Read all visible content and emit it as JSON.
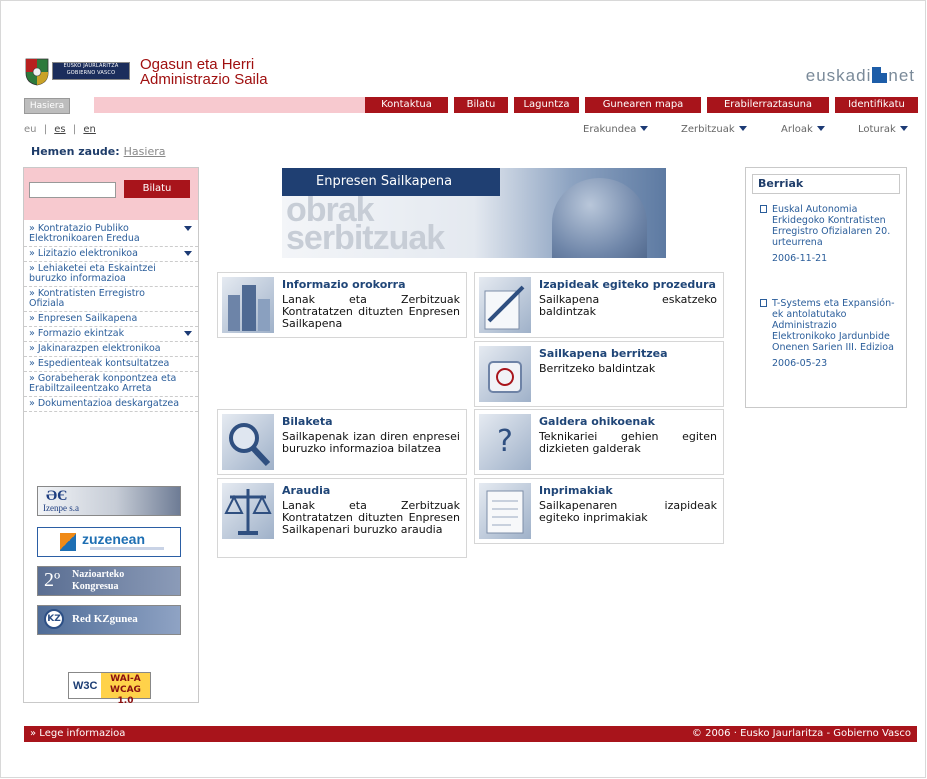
{
  "header": {
    "logo_line1": "EUSKO JAURLARITZA",
    "logo_line2": "GOBIERNO VASCO",
    "dept_line1": "Ogasun eta Herri",
    "dept_line2": "Administrazio Saila",
    "brand_left": "euskadi",
    "brand_right": "net"
  },
  "navbar": {
    "home": "Hasiera",
    "buttons": [
      "Kontaktua",
      "Bilatu",
      "Laguntza",
      "Gunearen mapa",
      "Erabilerraztasuna",
      "Identifikatu"
    ]
  },
  "langs": {
    "eu": "eu",
    "sep1": "|",
    "es": "es",
    "sep2": "|",
    "en": "en"
  },
  "menus": [
    "Erakundea",
    "Zerbitzuak",
    "Arloak",
    "Loturak"
  ],
  "breadcrumb": {
    "label": "Hemen zaude:",
    "current": "Hasiera"
  },
  "sidebar": {
    "search_value": "",
    "search_button": "Bilatu",
    "items": [
      "Kontratazio Publiko Elektronikoaren Eredua",
      "Lizitazio elektronikoa",
      "Lehiaketei eta Eskaintzei buruzko informazioa",
      "Kontratisten Erregistro Ofiziala",
      "Enpresen Sailkapena",
      "Formazio ekintzak",
      "Jakinarazpen elektronikoa",
      "Espedienteak kontsultatzea",
      "Gorabeherak konpontzea eta Erabiltzaileentzako Arreta",
      "Dokumentazioa deskargatzea"
    ],
    "banners": {
      "izenpe_mark": "ƏЄ",
      "izenpe_text": "Izenpe s.a",
      "zuzenean": "zuzenean",
      "kongresua_num": "2º",
      "kongresua_l1": "Nazioarteko",
      "kongresua_l2": "Kongresua",
      "kz_mark": "KZ",
      "kz_text": "Red KZgunea",
      "wai_w3c": "W3C",
      "wai_a": "WAI-A",
      "wai_wcag": "WCAG 1.0"
    }
  },
  "hero": {
    "title": "Enpresen Sailkapena",
    "bg_line1": "obrak",
    "bg_line2": "serbitzuak"
  },
  "cards": [
    {
      "title": "Informazio orokorra",
      "desc": "Lanak eta Zerbitzuak Kontratatzen dituzten Enpresen Sailkapena"
    },
    {
      "title": "Izapideak egiteko prozedura",
      "desc": "Sailkapena eskatzeko baldintzak"
    },
    {
      "title": "Sailkapena berritzea",
      "desc": "Berritzeko baldintzak"
    },
    {
      "title": "Bilaketa",
      "desc": "Sailkapenak izan diren enpresei buruzko informazioa bilatzea"
    },
    {
      "title": "Galdera ohikoenak",
      "desc": "Teknikariei gehien egiten dizkieten galderak"
    },
    {
      "title": "Araudia",
      "desc": "Lanak eta Zerbitzuak Kontratatzen dituzten Enpresen Sailkapenari buruzko araudia"
    },
    {
      "title": "Inprimakiak",
      "desc": "Sailkapenaren izapideak egiteko inprimakiak"
    }
  ],
  "news": {
    "title": "Berriak",
    "items": [
      {
        "text": "Euskal Autonomia Erkidegoko Kontratisten Erregistro Ofizialaren 20. urteurrena",
        "date": "2006-11-21"
      },
      {
        "text": "T-Systems eta Expansión-ek antolatutako Administrazio Elektronikoko Jardunbide Onenen Sarien III. Edizioa",
        "date": "2006-05-23"
      }
    ]
  },
  "footer": {
    "left": "» Lege informazioa",
    "right": "© 2006 · Eusko Jaurlaritza - Gobierno Vasco"
  },
  "colors": {
    "accent": "#a8141b",
    "navy": "#1f3f72",
    "pink": "#f7c9cf",
    "link": "#2a5d9a"
  }
}
